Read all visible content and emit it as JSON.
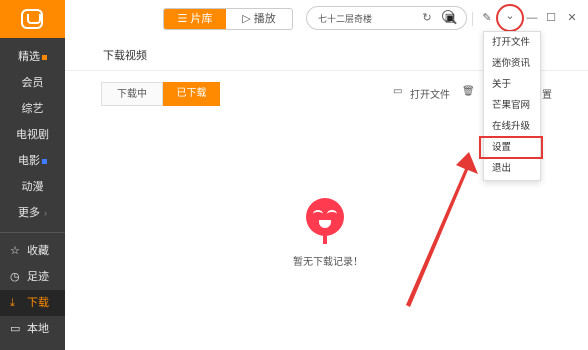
{
  "colors": {
    "accent": "#ff8a00",
    "sidebar": "#3b3b3b",
    "annotation": "#e53935"
  },
  "sidebar": {
    "logo": "mango-tv-logo",
    "items": [
      {
        "label": "精选",
        "badge": true
      },
      {
        "label": "会员"
      },
      {
        "label": "综艺"
      },
      {
        "label": "电视剧"
      },
      {
        "label": "电影",
        "badge": true
      },
      {
        "label": "动漫"
      },
      {
        "label": "更多",
        "chevron": "›"
      }
    ],
    "lower": [
      {
        "icon": "star-icon",
        "glyph": "☆",
        "label": "收藏"
      },
      {
        "icon": "clock-icon",
        "glyph": "◷",
        "label": "足迹"
      },
      {
        "icon": "download-icon",
        "glyph": "⤓",
        "label": "下载",
        "active": true
      },
      {
        "icon": "folder-icon",
        "glyph": "▭",
        "label": "本地"
      }
    ]
  },
  "topbar": {
    "library_label": "☰ 片库",
    "play_label": "▷ 播放",
    "search_text": "七十二层奇楼",
    "icons": {
      "refresh": "↻",
      "skin": "▣",
      "edit": "✎",
      "dropdown": "⌄",
      "minimize": "—",
      "maximize": "☐",
      "close": "✕"
    }
  },
  "content": {
    "title": "下载视频",
    "tab_downloading": "下载中",
    "tab_downloaded": "已下载",
    "open_file": "打开文件",
    "open_file_icon": "▭",
    "delete_icon": "🗑",
    "settings_partial": "置",
    "empty_text": "暂无下载记录！"
  },
  "menu": {
    "items": [
      "打开文件",
      "迷你资讯",
      "关于",
      "芒果官网",
      "在线升级",
      "设置",
      "退出"
    ],
    "highlighted": 5
  }
}
